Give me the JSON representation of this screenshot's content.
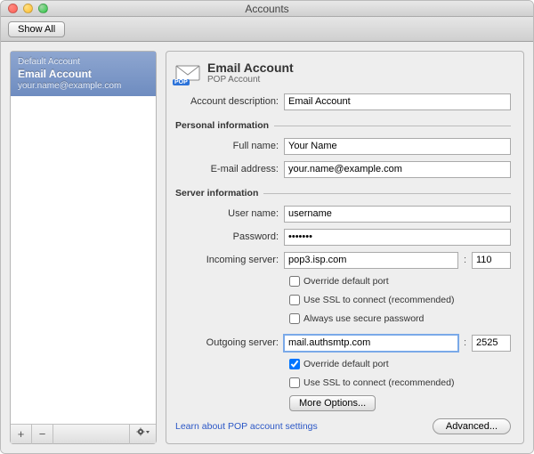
{
  "window": {
    "title": "Accounts"
  },
  "toolbar": {
    "show_all": "Show All"
  },
  "sidebar": {
    "item": {
      "category": "Default Account",
      "name": "Email Account",
      "sub": "your.name@example.com"
    },
    "add": "+",
    "remove": "−",
    "gear": "✲▾"
  },
  "header": {
    "title": "Email Account",
    "subtitle": "POP Account",
    "pop_badge": "POP"
  },
  "labels": {
    "account_description": "Account description:",
    "personal_info": "Personal information",
    "full_name": "Full name:",
    "email": "E-mail address:",
    "server_info": "Server information",
    "user_name": "User name:",
    "password": "Password:",
    "incoming": "Incoming server:",
    "outgoing": "Outgoing server:",
    "override_port": "Override default port",
    "use_ssl": "Use SSL to connect (recommended)",
    "secure_pw": "Always use secure password",
    "more_options": "More Options...",
    "learn_link": "Learn about POP account settings",
    "advanced": "Advanced...",
    "colon": ":"
  },
  "values": {
    "account_description": "Email Account",
    "full_name": "Your Name",
    "email": "your.name@example.com",
    "user_name": "username",
    "password": "•••••••",
    "incoming": "pop3.isp.com",
    "incoming_port": "110",
    "outgoing": "mail.authsmtp.com",
    "outgoing_port": "2525"
  },
  "checks": {
    "in_override": false,
    "in_ssl": false,
    "in_secure": false,
    "out_override": true,
    "out_ssl": false
  }
}
